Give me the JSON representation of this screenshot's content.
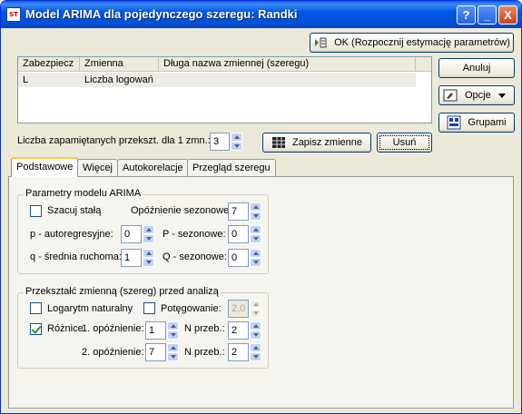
{
  "window": {
    "title": "Model ARIMA dla pojedynczego szeregu: Randki"
  },
  "titlebar_buttons": {
    "help": "?",
    "minimize": "_",
    "close": "X"
  },
  "buttons": {
    "ok": "OK (Rozpocznij estymację parametrów)",
    "cancel": "Anuluj",
    "options": "Opcje",
    "groups": "Grupami",
    "save_vars": "Zapisz zmienne",
    "delete": "Usuń"
  },
  "list": {
    "headers": [
      "Zabezpiecz",
      "Zmienna",
      "Długa nazwa zmiennej (szeregu)"
    ],
    "rows": [
      {
        "protect": "L",
        "variable": "Liczba logowań",
        "long_name": ""
      }
    ]
  },
  "memory": {
    "label": "Liczba zapamiętanych przekszt. dla 1 zmn.:",
    "value": "3"
  },
  "tabs": [
    "Podstawowe",
    "Więcej",
    "Autokorelacje",
    "Przegląd szeregu"
  ],
  "arima": {
    "title": "Parametry modelu ARIMA",
    "estimate_const": "Szacuj stałą",
    "seasonal_lag_label": "Opóźnienie sezonowe:",
    "seasonal_lag_value": "7",
    "p_label": "p - autoregresyjne:",
    "p_value": "0",
    "P_label": "P - sezonowe:",
    "P_value": "0",
    "q_label": "q - średnia ruchoma:",
    "q_value": "1",
    "Q_label": "Q - sezonowe:",
    "Q_value": "0"
  },
  "transform": {
    "title": "Przekształć zmienną (szereg) przed analizą",
    "log_label": "Logarytm naturalny",
    "power_label": "Potęgowanie:",
    "power_value": "2,0",
    "diff_label": "Różnice",
    "lag1_label": "1. opóźnienie:",
    "lag1_value": "1",
    "n1_label": "N przeb.:",
    "n1_value": "2",
    "lag2_label": "2. opóźnienie:",
    "lag2_value": "7",
    "n2_label": "N przeb.:",
    "n2_value": "2"
  }
}
